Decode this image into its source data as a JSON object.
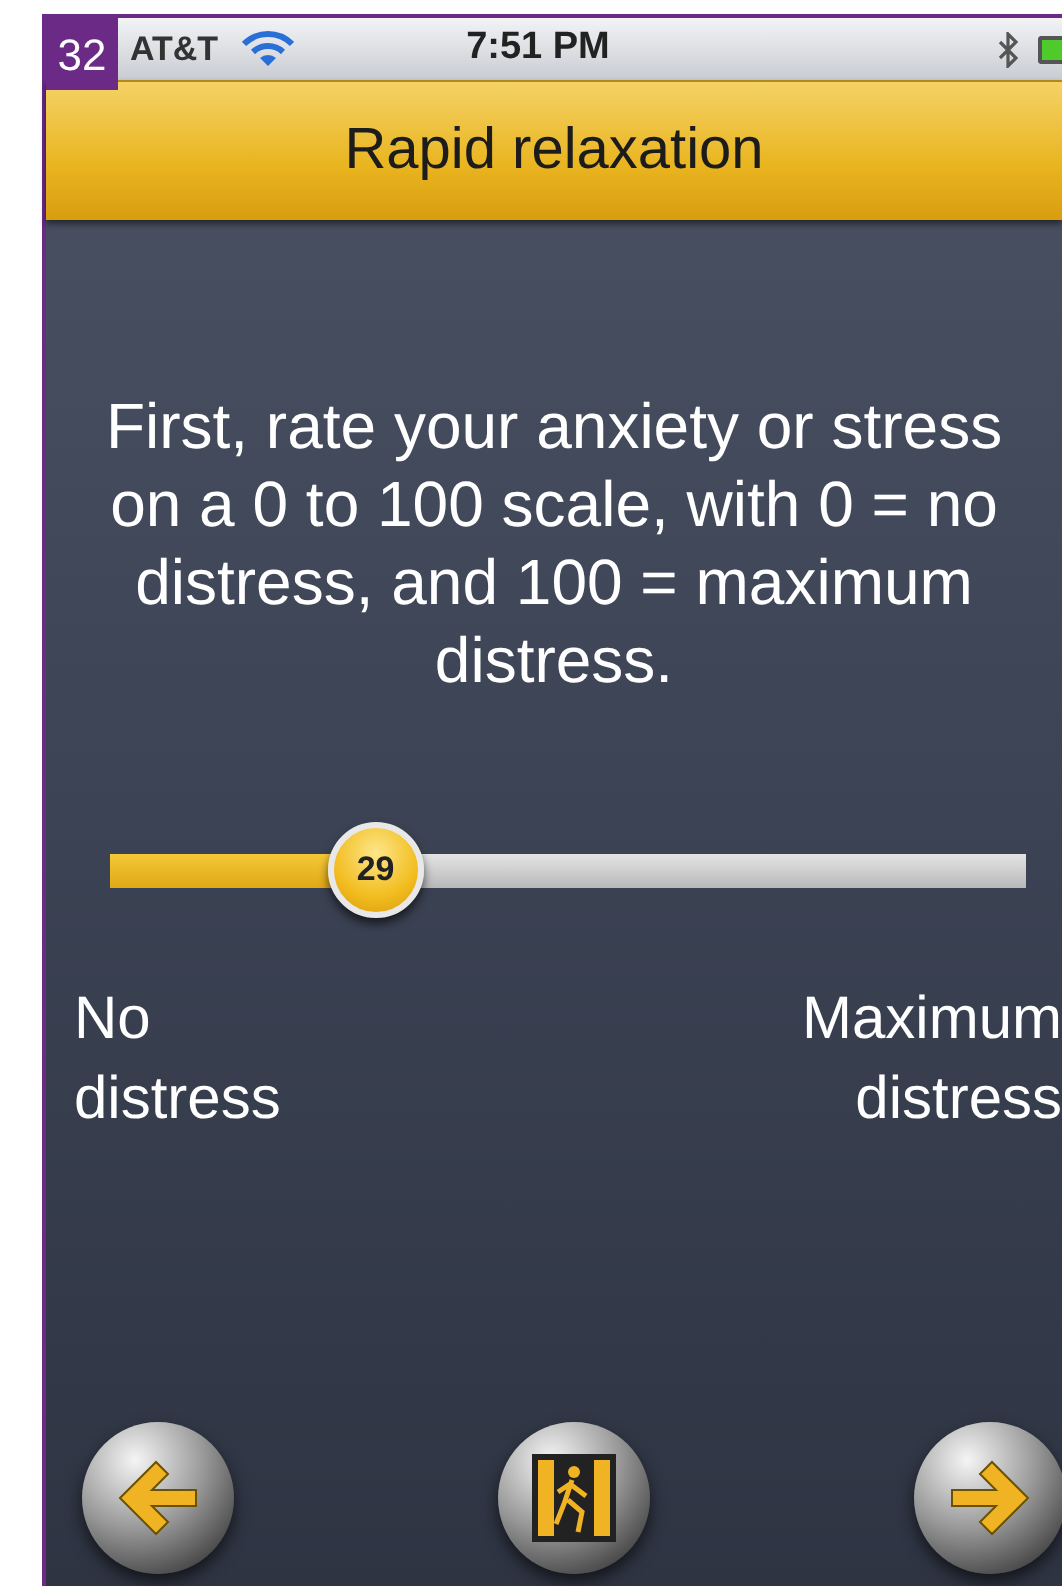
{
  "page_number": "32",
  "status_bar": {
    "carrier": "AT&T",
    "time": "7:51 PM"
  },
  "title": "Rapid relaxation",
  "instructions": "First, rate your anxiety or stress on a 0 to 100 scale, with 0 = no distress, and 100 = maximum distress.",
  "slider": {
    "level": 0.29,
    "value": "29",
    "min_label": "No distress",
    "max_label": "Maximum distress"
  }
}
